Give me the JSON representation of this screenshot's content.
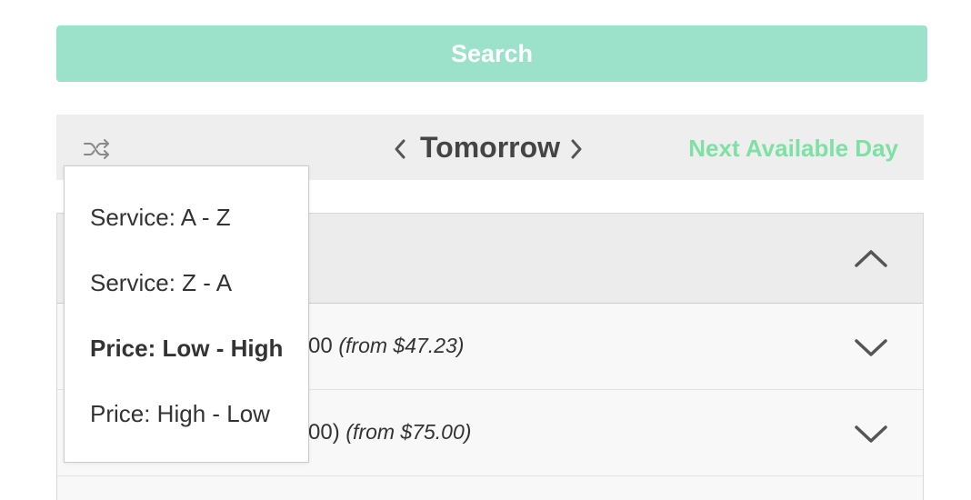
{
  "search": {
    "label": "Search",
    "color": "#9ce2cb"
  },
  "day_nav": {
    "shuffle_icon": "shuffle-icon",
    "prev_icon": "chevron-left-icon",
    "day_label": "Tomorrow",
    "next_icon": "chevron-right-icon",
    "next_available_label": "Next Available Day",
    "accent_color": "#7ee0a5"
  },
  "category": {
    "collapse_icon": "chevron-up-icon"
  },
  "services": [
    {
      "name_visible": "00",
      "price": "(from $47.23)",
      "expand_icon": "chevron-down-icon"
    },
    {
      "name_visible": "00)",
      "price": "(from $75.00)",
      "expand_icon": "chevron-down-icon"
    }
  ],
  "sort_menu": {
    "options": [
      {
        "label": "Service: A - Z",
        "selected": false
      },
      {
        "label": "Service: Z - A",
        "selected": false
      },
      {
        "label": "Price: Low - High",
        "selected": true
      },
      {
        "label": "Price: High - Low",
        "selected": false
      }
    ]
  }
}
